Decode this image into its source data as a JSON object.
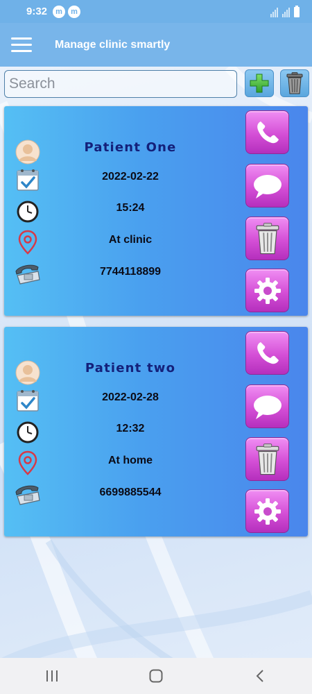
{
  "status_bar": {
    "time": "9:32",
    "notification_icons": [
      "m",
      "m"
    ]
  },
  "app_bar": {
    "title": "Manage clinic smartly",
    "menu_icon": "hamburger-menu-icon"
  },
  "search": {
    "placeholder": "Search",
    "value": ""
  },
  "toolbar": {
    "add_icon": "green-plus-icon",
    "delete_all_icon": "trash-can-icon"
  },
  "patients": [
    {
      "name": "Patient One",
      "date": "2022-02-22",
      "time": "15:24",
      "location": "At clinic",
      "phone": "7744118899"
    },
    {
      "name": "Patient two",
      "date": "2022-02-28",
      "time": "12:32",
      "location": "At home",
      "phone": "6699885544"
    }
  ],
  "card_actions": [
    "phone-call-icon",
    "message-bubble-icon",
    "trash-can-icon",
    "gear-icon"
  ],
  "colors": {
    "app_bar": "#78b5ea",
    "card_gradient_start": "#55bff4",
    "card_gradient_end": "#4a86ec",
    "action_button": "#d44fd6",
    "patient_name": "#14207a"
  }
}
